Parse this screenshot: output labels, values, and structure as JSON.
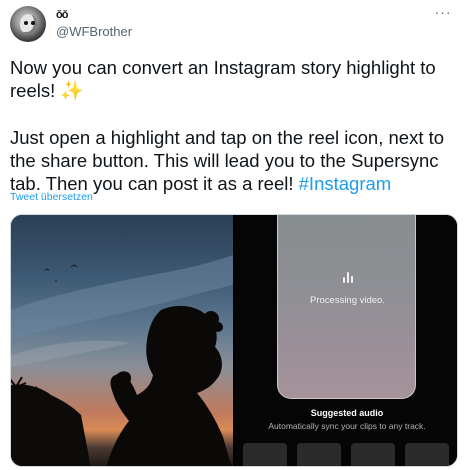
{
  "author": {
    "display_name": "ǒǒ",
    "handle": "@WFBrother",
    "avatar_icon": "profile-avatar"
  },
  "more_icon": "more-options-icon",
  "more_glyph": "···",
  "tweet": {
    "paragraph1": "Now you can convert an Instagram story highlight to reels! ",
    "sparkle": "✨",
    "paragraph2": "Just open a highlight and tap on the reel icon, next to the share button. This will lead you to the Supersync tab. Then you can post it as a reel! ",
    "hashtag": "#Instagram"
  },
  "translate_link": "Tweet übersetzen",
  "media": {
    "left_image": "silhouette-sunset-photo",
    "right_screen": {
      "status": "Processing video.",
      "suggested_audio_title": "Suggested audio",
      "suggested_audio_subtitle": "Automatically sync your clips to any track."
    }
  },
  "colors": {
    "link": "#1d9bf0",
    "text": "#0f1419",
    "secondary": "#536471"
  }
}
